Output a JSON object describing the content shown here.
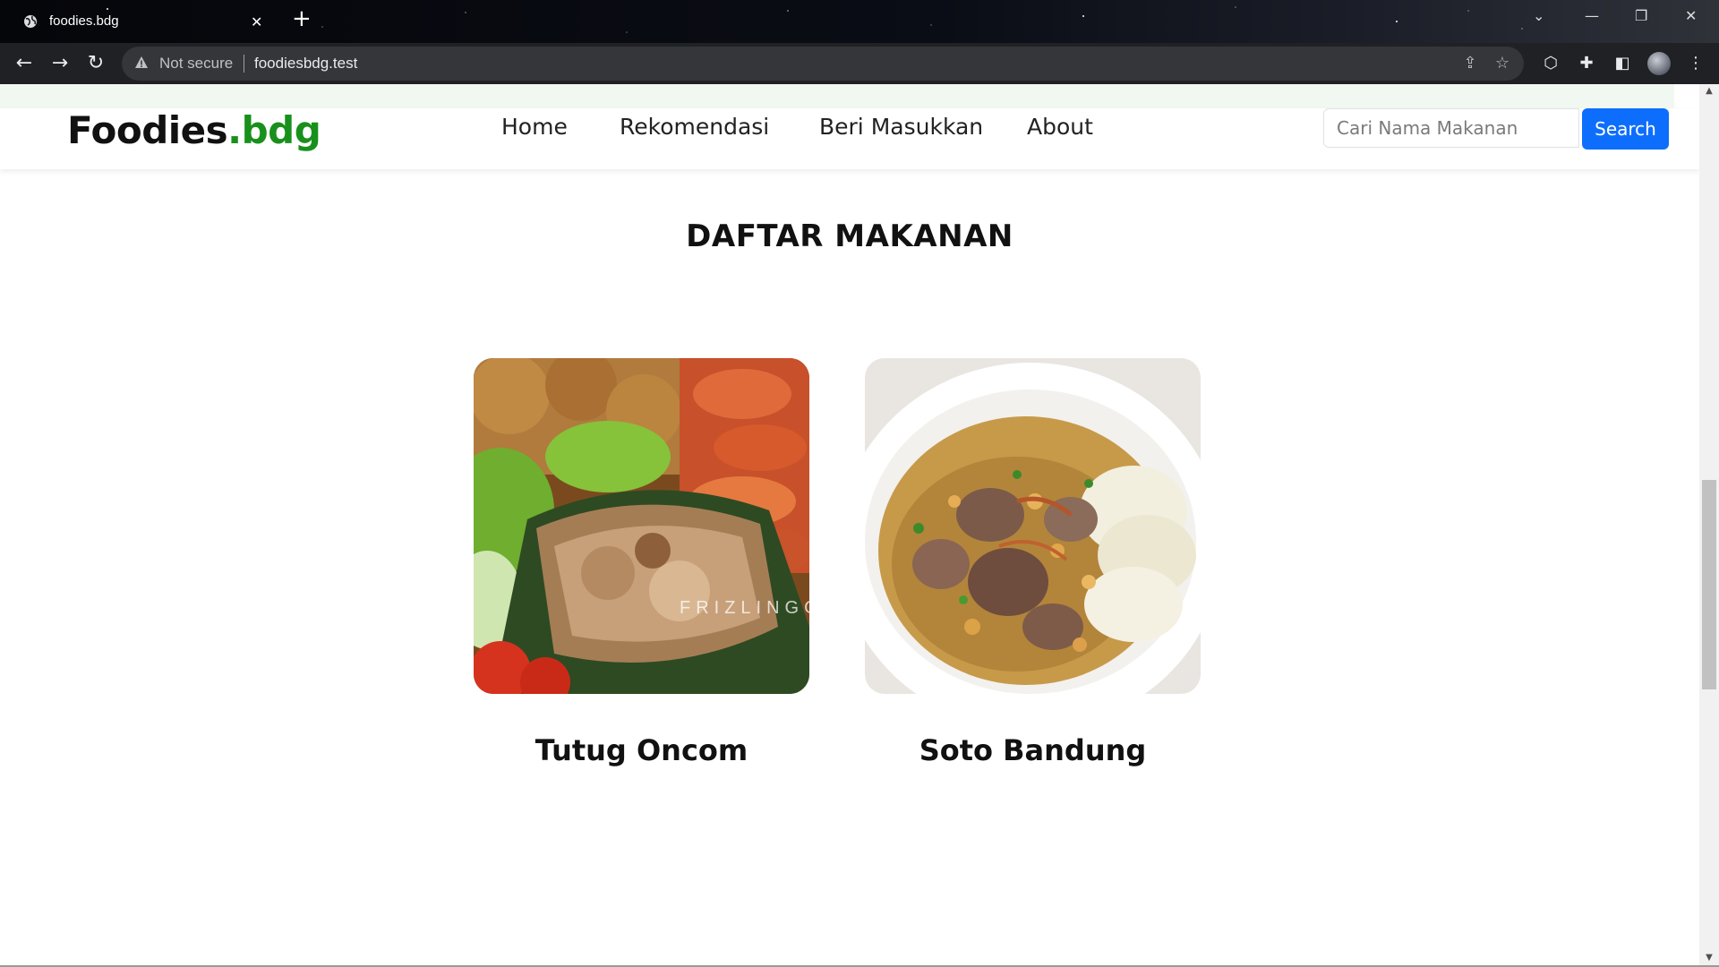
{
  "browser": {
    "tab_title": "foodies.bdg",
    "security_label": "Not secure",
    "url": "foodiesbdg.test"
  },
  "site": {
    "brand_main": "Foodies",
    "brand_accent": ".bdg",
    "nav": [
      "Home",
      "Rekomendasi",
      "Beri Masukkan",
      "About"
    ],
    "search_placeholder": "Cari Nama Makanan",
    "search_button": "Search",
    "section_title": "DAFTAR MAKANAN",
    "foods": [
      {
        "name": "Tutug Oncom",
        "watermark": "FRIZLINGGA"
      },
      {
        "name": "Soto Bandung"
      }
    ]
  },
  "colors": {
    "brand_accent": "#19901c",
    "search_button": "#0d6efd"
  }
}
